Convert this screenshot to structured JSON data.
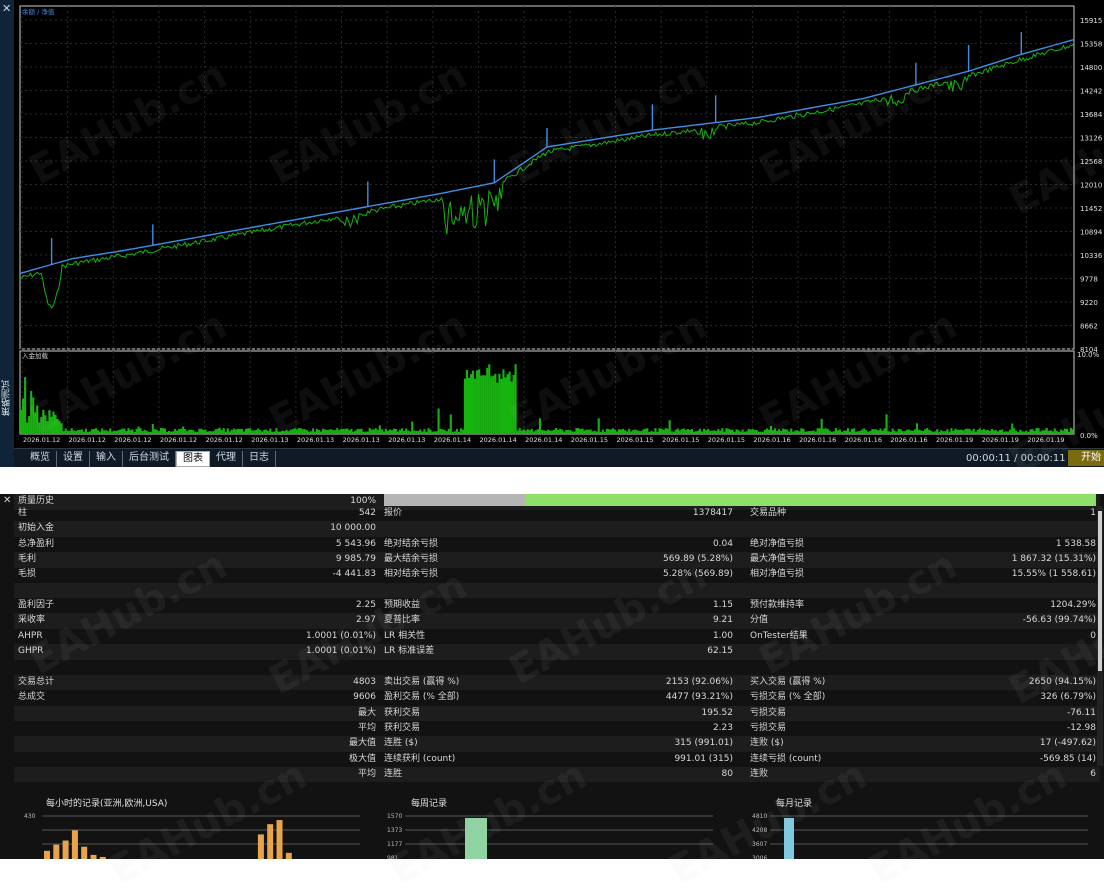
{
  "top_panel": {
    "side_label": "策略测试",
    "legend": "余额 / 净值",
    "sub_legend": "入金加载",
    "y_ticks": [
      "15915",
      "15358",
      "14800",
      "14242",
      "13684",
      "13126",
      "12568",
      "12010",
      "11452",
      "10894",
      "10336",
      "9778",
      "9220",
      "8662",
      "8104"
    ],
    "sub_ticks": [
      "10.0%",
      "0.0%"
    ],
    "x_ticks": [
      "2026.01.12",
      "2026.01.12",
      "2026.01.12",
      "2026.01.12",
      "2026.01.12",
      "2026.01.13",
      "2026.01.13",
      "2026.01.13",
      "2026.01.13",
      "2026.01.14",
      "2026.01.14",
      "2026.01.14",
      "2026.01.15",
      "2026.01.15",
      "2026.01.15",
      "2026.01.15",
      "2026.01.16",
      "2026.01.16",
      "2026.01.16",
      "2026.01.16",
      "2026.01.19",
      "2026.01.19",
      "2026.01.19"
    ],
    "tabs": [
      "概览",
      "设置",
      "输入",
      "后台测试",
      "图表",
      "代理",
      "日志"
    ],
    "active_tab": "图表",
    "timer": "00:00:11 / 00:00:11",
    "start_label": "开始",
    "colors": {
      "balance": "#3d8fe6",
      "equity": "#16b40e",
      "deposit_load": "#16b40e",
      "grid": "#2a2a2a"
    }
  },
  "chart_data": {
    "type": "line",
    "title": "",
    "series": [
      {
        "name": "余额",
        "x": [
          0,
          0.05,
          0.1,
          0.2,
          0.3,
          0.4,
          0.45,
          0.5,
          0.6,
          0.7,
          0.8,
          0.9,
          0.95,
          1.0
        ],
        "values": [
          9900,
          10250,
          10450,
          10900,
          11350,
          11800,
          12050,
          12900,
          13300,
          13600,
          14050,
          14700,
          15100,
          15450
        ]
      },
      {
        "name": "净值",
        "x": [
          0,
          0.05,
          0.1,
          0.2,
          0.3,
          0.4,
          0.45,
          0.5,
          0.6,
          0.7,
          0.8,
          0.9,
          0.95,
          1.0
        ],
        "values": [
          9900,
          8650,
          10300,
          10800,
          11200,
          11700,
          10650,
          12800,
          13200,
          13500,
          13900,
          14600,
          15000,
          15350
        ]
      }
    ],
    "ylim": [
      8104,
      15915
    ]
  },
  "report": {
    "quality_label": "质量历史",
    "quality_value": "100%",
    "quality_fraction": 0.8,
    "rows": [
      [
        [
          "柱",
          "542"
        ],
        [
          "报价",
          "1378417"
        ],
        [
          "交易品种",
          "1"
        ]
      ],
      [
        [
          "初始入金",
          "10 000.00"
        ],
        [
          "",
          ""
        ],
        [
          "",
          ""
        ]
      ],
      [
        [
          "总净盈利",
          "5 543.96"
        ],
        [
          "绝对结余亏损",
          "0.04"
        ],
        [
          "绝对净值亏损",
          "1 538.58"
        ]
      ],
      [
        [
          "毛利",
          "9 985.79"
        ],
        [
          "最大结余亏损",
          "569.89 (5.28%)"
        ],
        [
          "最大净值亏损",
          "1 867.32 (15.31%)"
        ]
      ],
      [
        [
          "毛损",
          "-4 441.83"
        ],
        [
          "相对结余亏损",
          "5.28% (569.89)"
        ],
        [
          "相对净值亏损",
          "15.55% (1 558.61)"
        ]
      ],
      [
        [
          "",
          ""
        ],
        [
          "",
          ""
        ],
        [
          "",
          ""
        ]
      ],
      [
        [
          "盈利因子",
          "2.25"
        ],
        [
          "预期收益",
          "1.15"
        ],
        [
          "预付款维持率",
          "1204.29%"
        ]
      ],
      [
        [
          "采收率",
          "2.97"
        ],
        [
          "夏普比率",
          "9.21"
        ],
        [
          "分值",
          "-56.63 (99.74%)"
        ]
      ],
      [
        [
          "AHPR",
          "1.0001 (0.01%)"
        ],
        [
          "LR 相关性",
          "1.00"
        ],
        [
          "OnTester结果",
          "0"
        ]
      ],
      [
        [
          "GHPR",
          "1.0001 (0.01%)"
        ],
        [
          "LR 标准误差",
          "62.15"
        ],
        [
          "",
          ""
        ]
      ],
      [
        [
          "",
          ""
        ],
        [
          "",
          ""
        ],
        [
          "",
          ""
        ]
      ],
      [
        [
          "交易总计",
          "4803"
        ],
        [
          "卖出交易 (赢得 %)",
          "2153 (92.06%)"
        ],
        [
          "买入交易 (赢得 %)",
          "2650 (94.15%)"
        ]
      ],
      [
        [
          "总成交",
          "9606"
        ],
        [
          "盈利交易 (% 全部)",
          "4477 (93.21%)"
        ],
        [
          "亏损交易 (% 全部)",
          "326 (6.79%)"
        ]
      ],
      [
        [
          "最大",
          ""
        ],
        [
          "获利交易",
          "195.52"
        ],
        [
          "亏损交易",
          "-76.11"
        ]
      ],
      [
        [
          "平均",
          ""
        ],
        [
          "获利交易",
          "2.23"
        ],
        [
          "亏损交易",
          "-12.98"
        ]
      ],
      [
        [
          "最大值",
          ""
        ],
        [
          "连胜 ($)",
          "315 (991.01)"
        ],
        [
          "连败 ($)",
          "17 (-497.62)"
        ]
      ],
      [
        [
          "极大值",
          ""
        ],
        [
          "连续获利 (count)",
          "991.01 (315)"
        ],
        [
          "连续亏损 (count)",
          "-569.85 (14)"
        ]
      ],
      [
        [
          "平均",
          ""
        ],
        [
          "连胜",
          "80"
        ],
        [
          "连败",
          "6"
        ]
      ]
    ],
    "hourly": {
      "title": "每小时的记录(亚洲,欧洲,USA)",
      "axis": [
        "430"
      ],
      "bars": [
        0.2,
        0.35,
        0.45,
        0.7,
        0.3,
        0.1,
        0.05,
        0.0,
        0.0,
        0.0,
        0.0,
        0.0,
        0.0,
        0.0,
        0.0,
        0.0,
        0.0,
        0.0,
        0.0,
        0.0,
        0.0,
        0.0,
        0.0,
        0.6,
        0.85,
        0.95,
        0.15
      ],
      "color": "#e8a44c"
    },
    "weekly": {
      "title": "每周记录",
      "axis": [
        "1570",
        "1373",
        "1177",
        "981"
      ],
      "bars": [
        1.0
      ],
      "color": "#8ed3a0"
    },
    "monthly": {
      "title": "每月记录",
      "axis": [
        "4810",
        "4208",
        "3607",
        "3006"
      ],
      "bars": [
        1.0
      ],
      "color": "#7fc8e0"
    },
    "watermark": "EAHub.cn"
  }
}
